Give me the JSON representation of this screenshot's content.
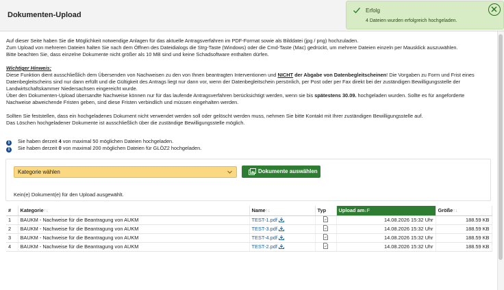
{
  "page_title": "Dokumenten-Upload",
  "toast": {
    "title": "Erfolg",
    "message": "4 Dateien wurden erfolgreich hochgeladen.",
    "accent": "#2e7d32"
  },
  "intro": [
    "Auf dieser Seite haben Sie die Möglichkeit notwendige Anlagen für das aktuelle Antragsverfahren im PDF-Format sowie als Bilddatei (jpg / png) hochzuladen.",
    "Zum Upload von mehreren Dateien halten Sie nach dem Öffnen des Dateidialogs die Strg-Taste (Windows) oder die Cmd-Taste (Mac) gedrückt, um mehrere Dateien einzeln per Mausklick auszuwählen.",
    "Bitte beachten Sie, dass einzelne Dokumente nicht größer als 10 MB sind und keine Schadsoftware enthalten dürfen."
  ],
  "hint": {
    "heading": "Wichtiger Hinweis:",
    "l1_a": "Diese Funktion dient ausschließlich dem Übersenden von Nachweisen zu den von Ihnen beantragten Interventionen und ",
    "l1_b": "NICHT",
    "l1_c": " der Abgabe von Datenbegleitscheinen",
    "l1_d": "! Die Vorgaben zu Form und Frist eines",
    "l2": "Datenbegleitscheins sind nur dann erfüllt und die Gültigkeit des Antrags liegt nur dann vor, wenn der Datenbegleitschein persönlich, per Post oder per Fax direkt bei der zuständigen Bewilligungsstelle der",
    "l3": "Landwirtschaftskammer Niedersachsen eingereicht wurde.",
    "l4_a": "Über den Dokumenten-Upload übersandte Nachweise können nur für das laufende Antragsverfahren berücksichtigt werden, wenn sie bis ",
    "l4_b": "spätestens 30.09.",
    "l4_c": " hochgeladen wurden. Sollte es für angeforderte",
    "l5": "Nachweise abweichende Fristen geben, sind diese Fristen verbindlich und müssen eingehalten werden."
  },
  "note": [
    "Sollten Sie feststellen, dass ein hochgeladenes Dokument nicht verwendet werden soll oder gelöscht werden muss, nehmen Sie bitte Kontakt mit Ihrer zuständigen Bewilligungsstelle auf.",
    "Das Löschen hochgeladener Dokumente ist ausschließlich über die zuständige Bewilligungsstelle möglich."
  ],
  "info": [
    {
      "pre": "Sie haben derzeit ",
      "count": "4",
      "post": " von maximal 50 möglichen Dateien hochgeladen."
    },
    {
      "pre": "Sie haben derzeit ",
      "count": "0",
      "post": " von maximal 200 möglichen Dateien für GLÖZ2 hochgeladen."
    }
  ],
  "upload": {
    "category_value": "Kategorie wählen",
    "choose_label": "Dokumente auswählen",
    "empty_msg": "Kein(e) Dokument(e) für den Upload ausgewählt."
  },
  "table": {
    "headers": {
      "num": "#",
      "category": "Kategorie",
      "name": "Name",
      "type": "Typ",
      "upload": "Upload am",
      "size": "Größe"
    },
    "rows": [
      {
        "num": "1",
        "category": "BAUKM - Nachweise für die Beantragung von AUKM",
        "name": "TEST-1.pdf",
        "uploaded": "14.08.2026 15:32 Uhr",
        "size": "188.59 KB"
      },
      {
        "num": "2",
        "category": "BAUKM - Nachweise für die Beantragung von AUKM",
        "name": "TEST-3.pdf",
        "uploaded": "14.08.2026 15:32 Uhr",
        "size": "188.59 KB"
      },
      {
        "num": "3",
        "category": "BAUKM - Nachweise für die Beantragung von AUKM",
        "name": "TEST-4.pdf",
        "uploaded": "14.08.2026 15:32 Uhr",
        "size": "188.59 KB"
      },
      {
        "num": "4",
        "category": "BAUKM - Nachweise für die Beantragung von AUKM",
        "name": "TEST-2.pdf",
        "uploaded": "14.08.2026 15:32 Uhr",
        "size": "188.59 KB"
      }
    ]
  },
  "colors": {
    "header_bg": "#f3f3f3",
    "toast_bg": "#d7ecc4",
    "primary_green": "#2e7d32",
    "select_bg": "#fbd982",
    "link": "#1a5fa8",
    "info_icon": "#1d4f91"
  }
}
